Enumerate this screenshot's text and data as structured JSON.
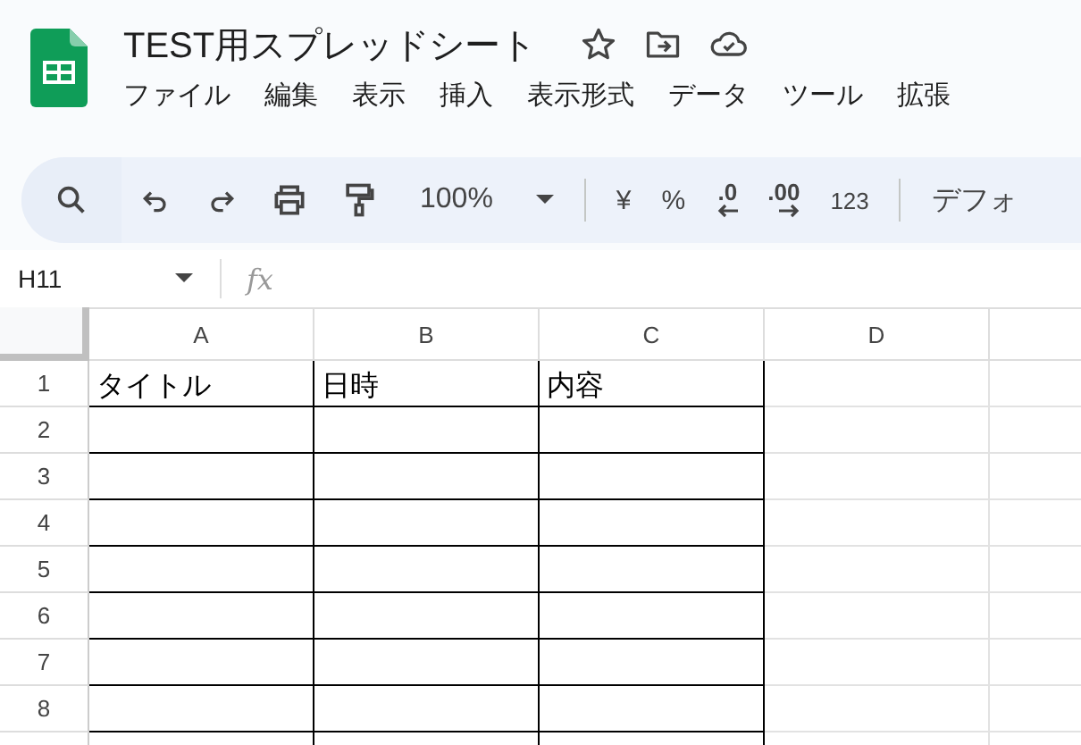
{
  "document": {
    "title": "TEST用スプレッドシート"
  },
  "menu": [
    "ファイル",
    "編集",
    "表示",
    "挿入",
    "表示形式",
    "データ",
    "ツール",
    "拡張"
  ],
  "toolbar": {
    "zoom": "100%",
    "currency": "¥",
    "percent": "%",
    "decrease_decimal": ".0",
    "increase_decimal": ".00",
    "number_format": "123",
    "font": "デフォ"
  },
  "formula_bar": {
    "cell_ref": "H11",
    "fx": "fx"
  },
  "columns": [
    "A",
    "B",
    "C",
    "D"
  ],
  "rows": [
    {
      "number": "1",
      "cells": [
        "タイトル",
        "日時",
        "内容"
      ],
      "bordered": true
    },
    {
      "number": "2",
      "bordered": true
    },
    {
      "number": "3",
      "bordered": true
    },
    {
      "number": "4",
      "bordered": true
    },
    {
      "number": "5",
      "bordered": true
    },
    {
      "number": "6",
      "bordered": true
    },
    {
      "number": "7",
      "bordered": true
    },
    {
      "number": "8",
      "bordered": true
    }
  ]
}
